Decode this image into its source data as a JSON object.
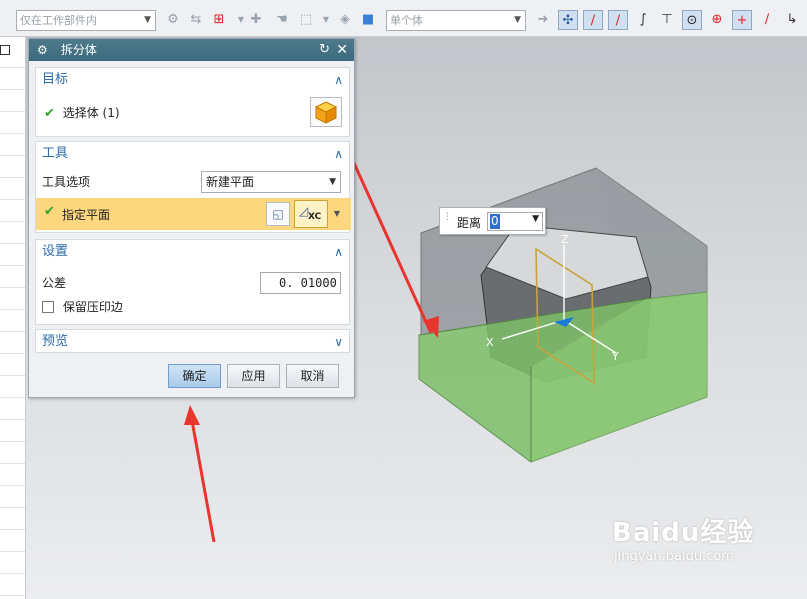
{
  "toolbar": {
    "filter_placeholder": "",
    "filter_value": "仅在工作部件内",
    "body_rule_value": "单个体"
  },
  "dialog": {
    "title": "拆分体",
    "target": {
      "heading": "目标",
      "select_body_label": "选择体 (1)"
    },
    "tool": {
      "heading": "工具",
      "option_label": "工具选项",
      "option_value": "新建平面",
      "specify_plane_label": "指定平面",
      "plane_button_label": "XC"
    },
    "settings": {
      "heading": "设置",
      "tolerance_label": "公差",
      "tolerance_value": "0. 01000",
      "keep_imprint_label": "保留压印边"
    },
    "preview": {
      "heading": "预览"
    },
    "buttons": {
      "ok": "确定",
      "apply": "应用",
      "cancel": "取消"
    }
  },
  "float_input": {
    "label": "距离",
    "value": "0"
  },
  "viewport": {
    "axis_x": "X",
    "axis_y": "Y",
    "axis_z": "Z"
  },
  "watermark": {
    "brand": "Baidu经验",
    "url": "jingyan.baidu.com"
  },
  "colors": {
    "title_bar": "#3f6c7f",
    "section_heading": "#2c6aa8",
    "highlight_row": "#fcd77e",
    "check": "#2da52d",
    "annotation_arrow": "#e8352d",
    "cut_body": "#7fbf6a"
  }
}
